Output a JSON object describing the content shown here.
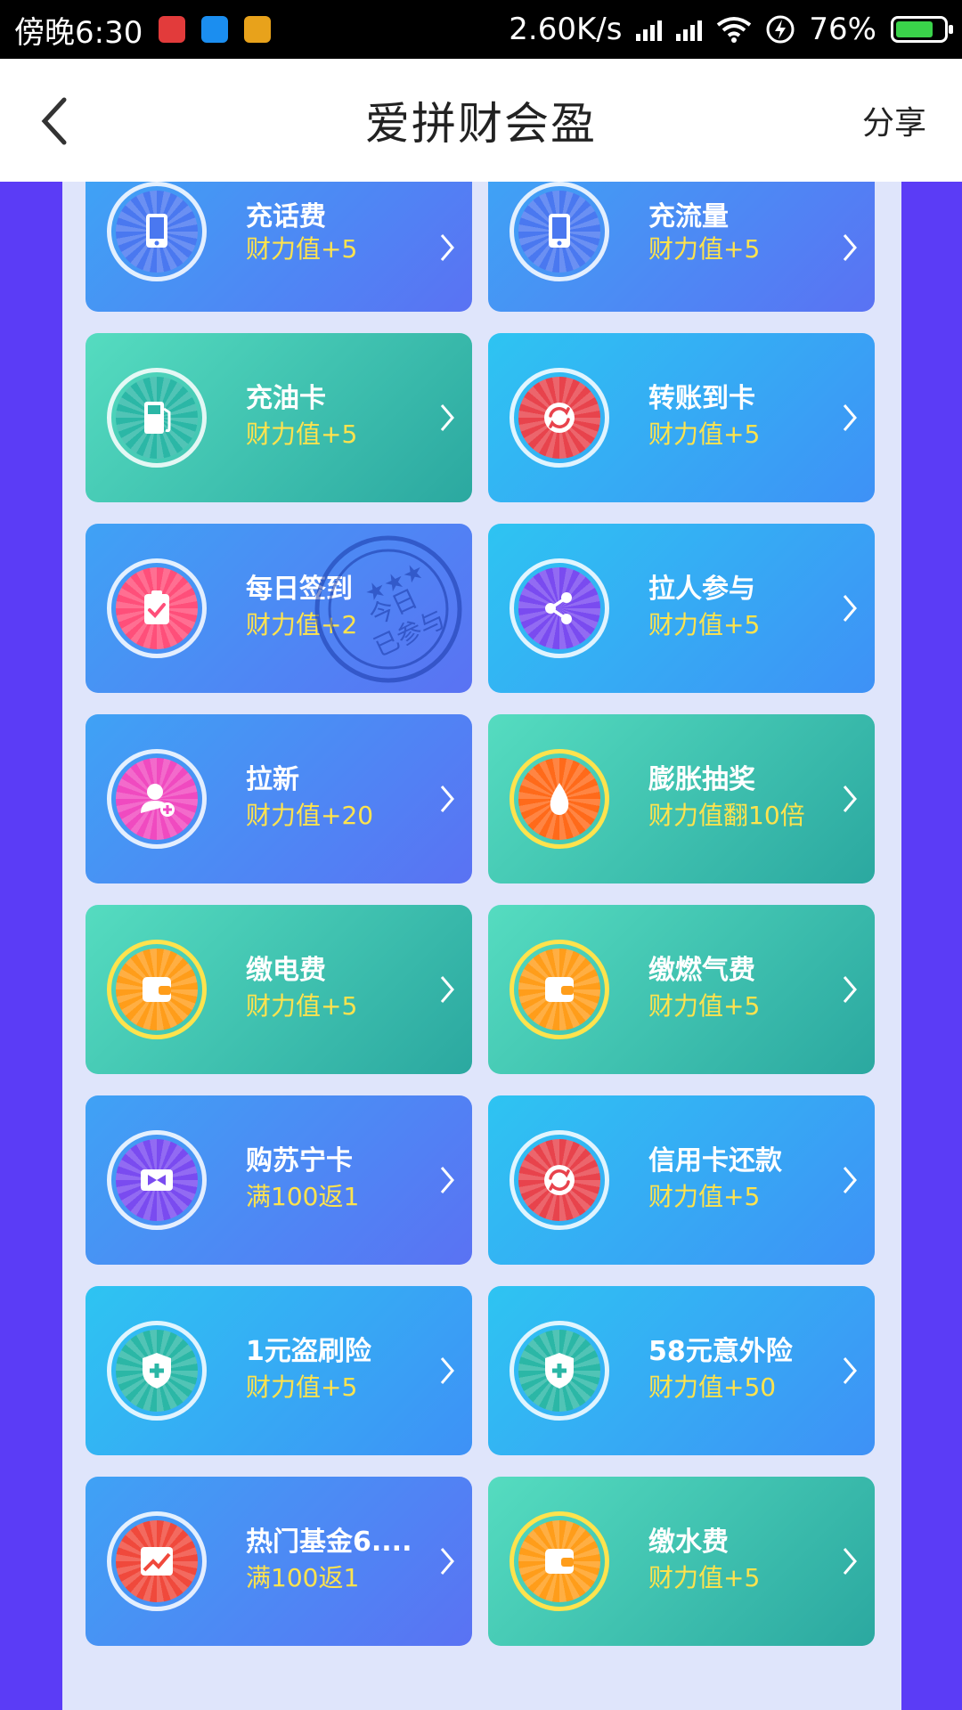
{
  "status_bar": {
    "time": "傍晚6:30",
    "network_speed": "2.60K/s",
    "battery": "76%"
  },
  "header": {
    "title": "爱拼财会盈",
    "share": "分享",
    "back_icon": "chevron-left-icon"
  },
  "stamp": {
    "line1": "今日",
    "line2": "已参与"
  },
  "cards": [
    {
      "label": "充话费",
      "reward": "财力值+5",
      "icon": "phone-icon",
      "color": "#4a78f0"
    },
    {
      "label": "充流量",
      "reward": "财力值+5",
      "icon": "phone-icon",
      "color": "#4a78f0"
    },
    {
      "label": "充油卡",
      "reward": "财力值+5",
      "icon": "fuel-pump-icon",
      "color": "#2bb7a6"
    },
    {
      "label": "转账到卡",
      "reward": "财力值+5",
      "icon": "exchange-icon",
      "color": "#e8434c"
    },
    {
      "label": "每日签到",
      "reward": "财力值+2",
      "icon": "clipboard-check-icon",
      "color": "#ff4f7a"
    },
    {
      "label": "拉人参与",
      "reward": "财力值+5",
      "icon": "share-icon",
      "color": "#7a4bf0"
    },
    {
      "label": "拉新",
      "reward": "财力值+20",
      "icon": "add-user-icon",
      "color": "#f04ac0"
    },
    {
      "label": "膨胀抽奖",
      "reward": "财力值翻10倍",
      "icon": "drop-icon",
      "color": "#ff6a1a"
    },
    {
      "label": "缴电费",
      "reward": "财力值+5",
      "icon": "wallet-icon",
      "color": "#ff9d1a"
    },
    {
      "label": "缴燃气费",
      "reward": "财力值+5",
      "icon": "wallet-icon",
      "color": "#ff9d1a"
    },
    {
      "label": "购苏宁卡",
      "reward": "满100返1",
      "icon": "card-bow-icon",
      "color": "#7a4bf0"
    },
    {
      "label": "信用卡还款",
      "reward": "财力值+5",
      "icon": "exchange-icon",
      "color": "#e8434c"
    },
    {
      "label": "1元盗刷险",
      "reward": "财力值+5",
      "icon": "shield-plus-icon",
      "color": "#2bb7a6"
    },
    {
      "label": "58元意外险",
      "reward": "财力值+50",
      "icon": "shield-plus-icon",
      "color": "#2bb7a6"
    },
    {
      "label": "热门基金6....",
      "reward": "满100返1",
      "icon": "trend-chart-icon",
      "color": "#f0493c"
    },
    {
      "label": "缴水费",
      "reward": "财力值+5",
      "icon": "wallet-icon",
      "color": "#ff9d1a"
    }
  ]
}
